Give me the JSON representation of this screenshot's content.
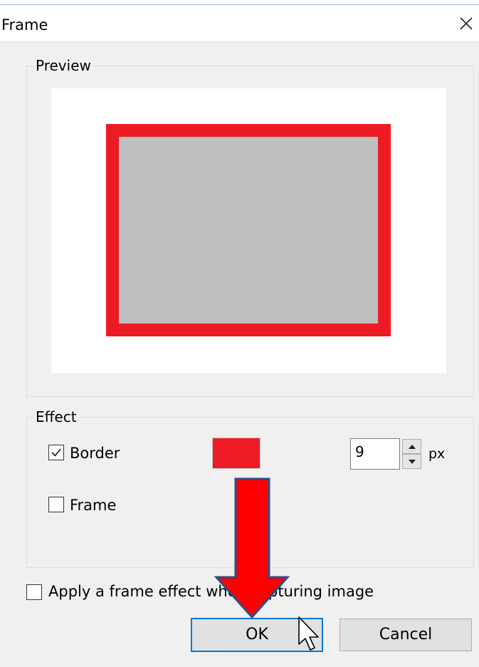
{
  "dialog": {
    "title": "Frame"
  },
  "preview": {
    "group_label": "Preview",
    "border_color": "#ed1c24",
    "fill_color": "#bfbfbf"
  },
  "effect": {
    "group_label": "Effect",
    "border": {
      "label": "Border",
      "checked": true,
      "color": "#ed1c24",
      "width_value": "9",
      "unit": "px"
    },
    "frame": {
      "label": "Frame",
      "checked": false
    }
  },
  "apply_on_capture": {
    "label": "Apply a frame effect when capturing image",
    "checked": false
  },
  "buttons": {
    "ok": "OK",
    "cancel": "Cancel"
  },
  "icons": [
    "close-icon",
    "check-icon",
    "spin-up-icon",
    "spin-down-icon",
    "mouse-cursor-icon",
    "red-down-arrow-annotation"
  ]
}
